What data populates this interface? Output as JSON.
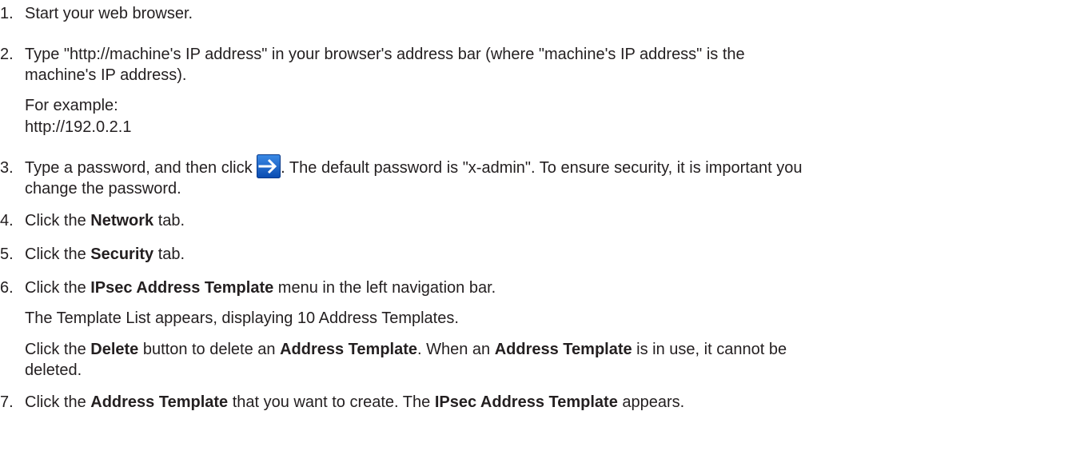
{
  "steps": [
    {
      "num": "1.",
      "text": "Start your web browser."
    },
    {
      "num": "2.",
      "line1": "Type \"http://machine's IP address\" in your browser's address bar (where \"machine's IP address\" is the",
      "line2": "machine's IP address).",
      "example_label": "For example:",
      "example_url": "http://192.0.2.1"
    },
    {
      "num": "3.",
      "before_icon": "Type a password, and then click",
      "after_icon": ". The default password is \"x-admin\". To ensure security, it is important you",
      "line2": "change the password.",
      "icon": "right-arrow-icon"
    },
    {
      "num": "4.",
      "pre": "Click the ",
      "bold": "Network",
      "post": " tab."
    },
    {
      "num": "5.",
      "pre": "Click the ",
      "bold": "Security",
      "post": " tab."
    },
    {
      "num": "6.",
      "pre": "Click the ",
      "bold": "IPsec Address Template",
      "post": " menu in the left navigation bar.",
      "sub1": "The Template List appears, displaying 10 Address Templates.",
      "sub2_pre": "Click the ",
      "sub2_bold1": "Delete",
      "sub2_mid1": " button to delete an ",
      "sub2_bold2": "Address Template",
      "sub2_mid2": ". When an ",
      "sub2_bold3": "Address Template",
      "sub2_post": " is in use, it cannot be",
      "sub2_line2": "deleted."
    },
    {
      "num": "7.",
      "pre": "Click the ",
      "bold1": "Address Template",
      "mid": " that you want to create. The ",
      "bold2": "IPsec Address Template",
      "post": " appears."
    }
  ],
  "colors": {
    "text": "#231f20",
    "icon_blue": "#1a64c8",
    "icon_dark": "#0a3d8f"
  }
}
